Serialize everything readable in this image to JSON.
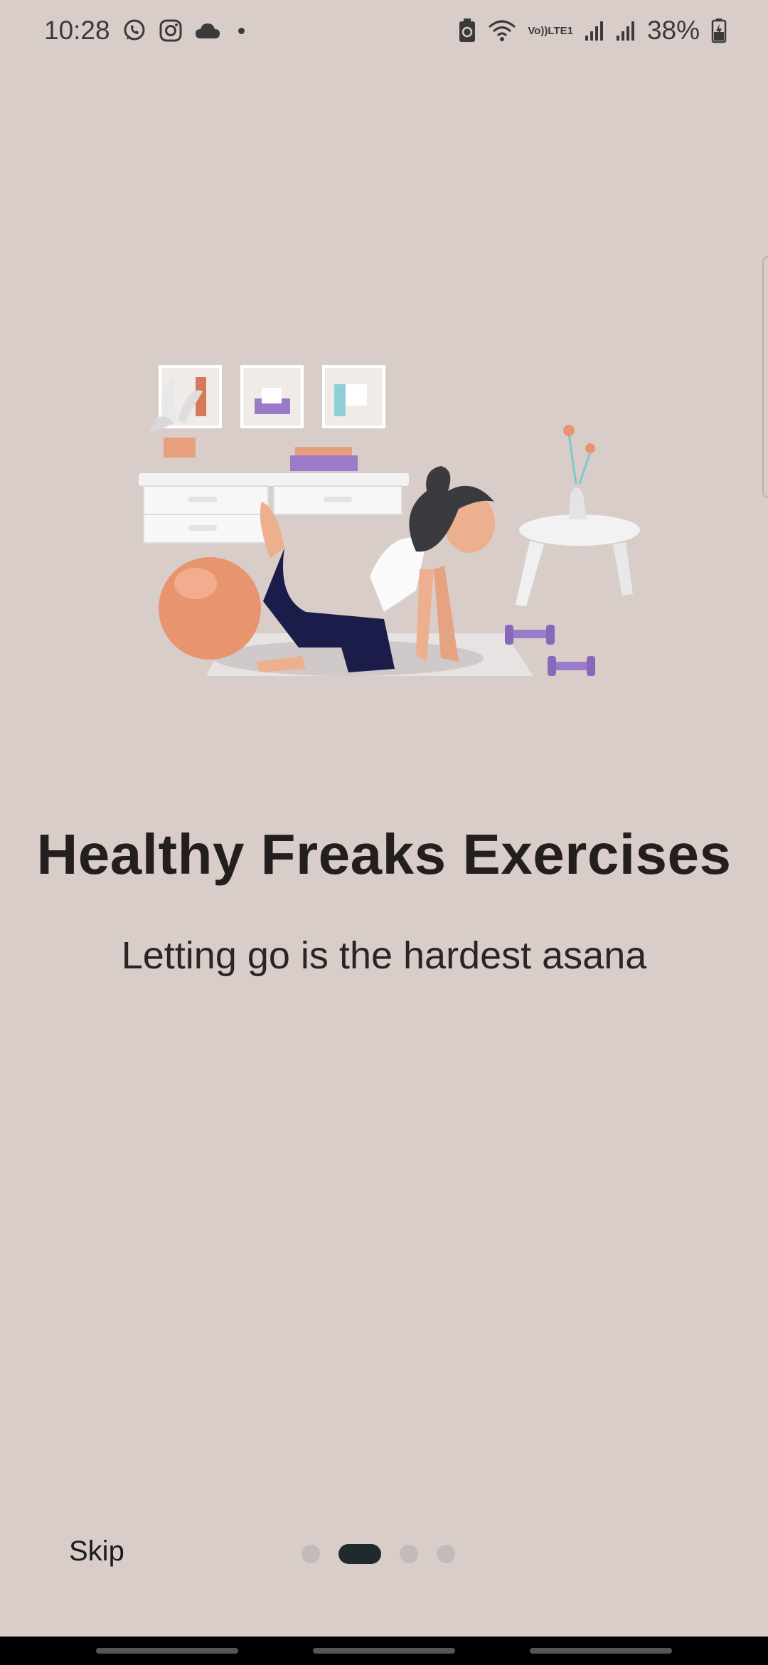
{
  "status_bar": {
    "time": "10:28",
    "battery": "38%",
    "volte_line1": "Vo))",
    "volte_line2": "LTE1",
    "icons_left": [
      "whatsapp-icon",
      "instagram-icon",
      "cloud-icon",
      "dot-icon"
    ],
    "icons_right": [
      "battery-saver-icon",
      "wifi-icon",
      "volte-icon",
      "signal-icon",
      "signal-icon",
      "battery-icon"
    ]
  },
  "onboarding": {
    "title": "Healthy Freaks Exercises",
    "subtitle": "Letting go is the hardest asana",
    "illustration": "woman-exercise-illustration",
    "skip_label": "Skip",
    "page_count": 4,
    "active_page": 2
  },
  "colors": {
    "background": "#d9cdca",
    "title_text": "#231f1f",
    "active_dot": "#1f2a2c",
    "inactive_dot": "#c3bbb9",
    "accent_orange": "#e8946f",
    "accent_purple": "#9b7bc9"
  }
}
